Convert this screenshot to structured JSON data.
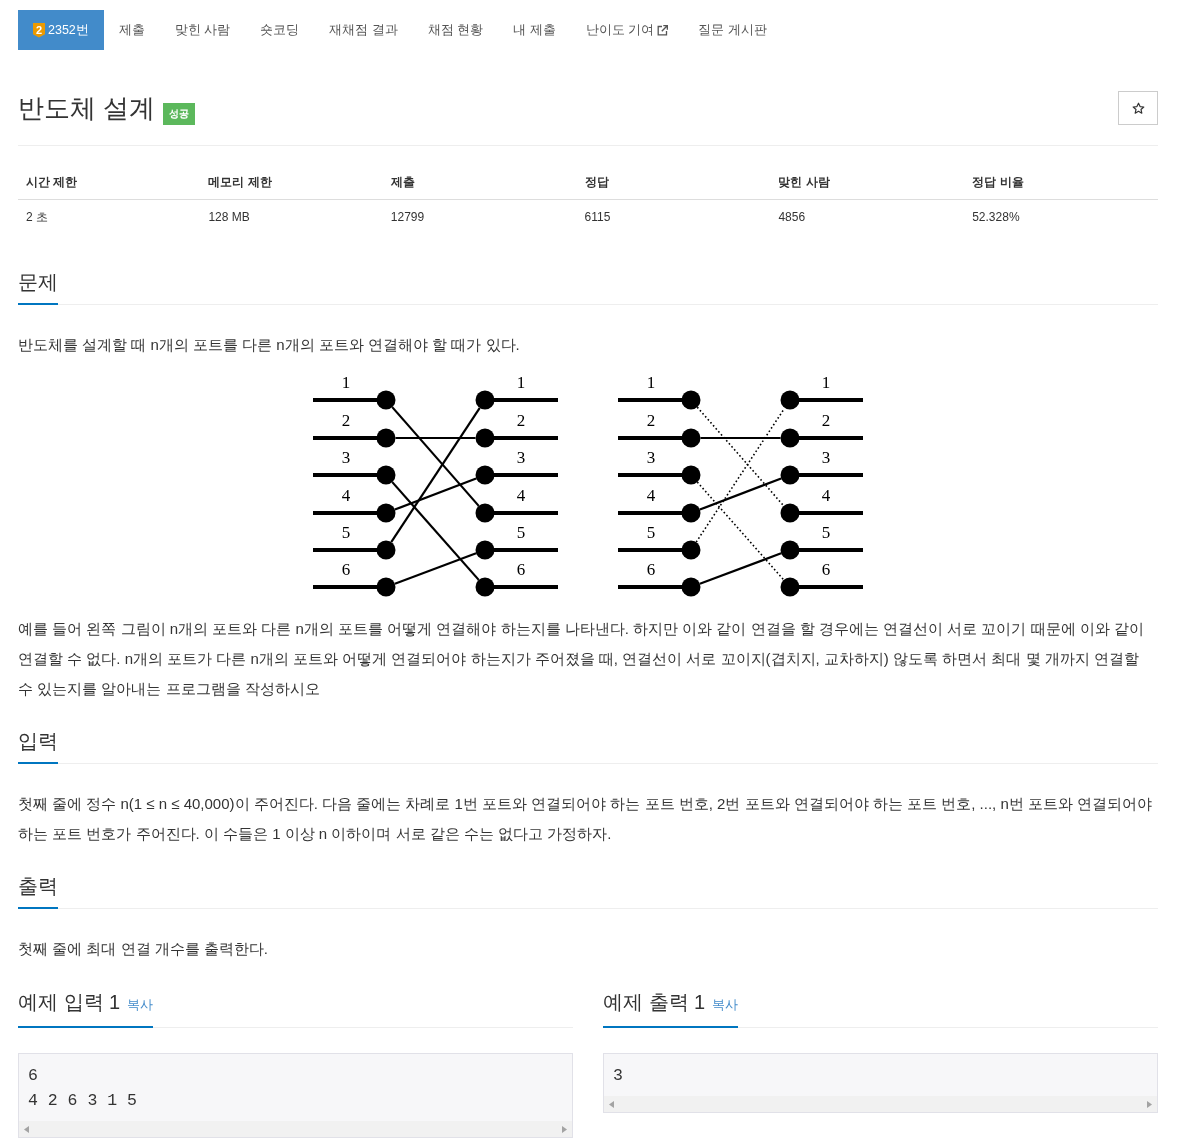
{
  "tabs": [
    {
      "label": "2352번",
      "tier": "2",
      "external": false,
      "selected": true
    },
    {
      "label": "제출",
      "external": false,
      "selected": false
    },
    {
      "label": "맞힌 사람",
      "external": false,
      "selected": false
    },
    {
      "label": "숏코딩",
      "external": false,
      "selected": false
    },
    {
      "label": "재채점 결과",
      "external": false,
      "selected": false
    },
    {
      "label": "채점 현황",
      "external": false,
      "selected": false
    },
    {
      "label": "내 제출",
      "external": false,
      "selected": false
    },
    {
      "label": "난이도 기여",
      "external": true,
      "selected": false
    },
    {
      "label": "질문 게시판",
      "external": false,
      "selected": false
    }
  ],
  "title": {
    "text": "반도체 설계",
    "badge": "성공"
  },
  "star_button": {
    "starred": false
  },
  "stats": {
    "columns": [
      "시간 제한",
      "메모리 제한",
      "제출",
      "정답",
      "맞힌 사람",
      "정답 비율"
    ],
    "rows": [
      [
        "2 초",
        "128 MB",
        "12799",
        "6115",
        "4856",
        "52.328%"
      ]
    ]
  },
  "sections": [
    {
      "heading": "문제",
      "blocks": [
        {
          "kind": "text",
          "text": "반도체를 설계할 때 n개의 포트를 다른 n개의 포트와 연결해야 할 때가 있다."
        },
        {
          "kind": "figure",
          "panels": [
            {
              "left_labels": [
                "1",
                "2",
                "3",
                "4",
                "5",
                "6"
              ],
              "right_labels": [
                "1",
                "2",
                "3",
                "4",
                "5",
                "6"
              ],
              "links": [
                {
                  "dotted": false
                },
                {
                  "dotted": false
                },
                {
                  "dotted": false
                },
                {
                  "dotted": false
                },
                {
                  "dotted": false
                },
                {
                  "dotted": false
                }
              ]
            },
            {
              "left_labels": [
                "1",
                "2",
                "3",
                "4",
                "5",
                "6"
              ],
              "right_labels": [
                "1",
                "2",
                "3",
                "4",
                "5",
                "6"
              ],
              "links": [
                {
                  "dotted": true
                },
                {
                  "dotted": false
                },
                {
                  "dotted": true
                },
                {
                  "dotted": false
                },
                {
                  "dotted": true
                },
                {
                  "dotted": false
                }
              ]
            }
          ]
        },
        {
          "kind": "text",
          "text": "예를 들어 왼쪽 그림이 n개의 포트와 다른 n개의 포트를 어떻게 연결해야 하는지를 나타낸다. 하지만 이와 같이 연결을 할 경우에는 연결선이 서로 꼬이기 때문에 이와 같이 연결할 수 없다. n개의 포트가 다른 n개의 포트와 어떻게 연결되어야 하는지가 주어졌을 때, 연결선이 서로 꼬이지(겹치지, 교차하지) 않도록 하면서 최대 몇 개까지 연결할 수 있는지를 알아내는 프로그램을 작성하시오"
        }
      ]
    },
    {
      "heading": "입력",
      "blocks": [
        {
          "kind": "text",
          "text": "첫째 줄에 정수 n(1 ≤ n ≤ 40,000)이 주어진다. 다음 줄에는 차례로 1번 포트와 연결되어야 하는 포트 번호, 2번 포트와 연결되어야 하는 포트 번호, ..., n번 포트와 연결되어야 하는 포트 번호가 주어진다. 이 수들은 1 이상 n 이하이며 서로 같은 수는 없다고 가정하자."
        }
      ]
    },
    {
      "heading": "출력",
      "blocks": [
        {
          "kind": "text",
          "text": "첫째 줄에 최대 연결 개수를 출력한다."
        }
      ]
    }
  ],
  "samples": [
    {
      "title": "예제 입력 1",
      "copy": "복사",
      "text": "6\n4 2 6 3 1 5"
    },
    {
      "title": "예제 출력 1",
      "copy": "복사",
      "text": "3"
    }
  ]
}
